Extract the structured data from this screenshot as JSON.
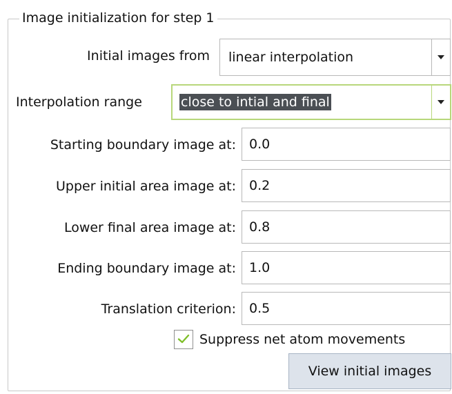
{
  "group": {
    "title": "Image initialization for step 1"
  },
  "initial_images": {
    "label": "Initial images from",
    "value": "linear interpolation"
  },
  "interpolation_range": {
    "label": "Interpolation range",
    "value": "close to intial and final"
  },
  "fields": [
    {
      "label": "Starting boundary image at:",
      "value": "0.0"
    },
    {
      "label": "Upper initial area image at:",
      "value": "0.2"
    },
    {
      "label": "Lower final area image at:",
      "value": "0.8"
    },
    {
      "label": "Ending boundary image at:",
      "value": "1.0"
    },
    {
      "label": "Translation criterion:",
      "value": "0.5"
    }
  ],
  "suppress": {
    "label": "Suppress net atom movements",
    "checked": true
  },
  "view_button": {
    "label": "View initial images"
  },
  "colors": {
    "checkmark": "#7fbf2a",
    "focus_border": "#b7d77a",
    "selection": "#4b4f54",
    "button": "#dde3eb"
  },
  "icons": {
    "combo_arrow": "chevron-down-icon",
    "check": "checkmark-icon"
  }
}
